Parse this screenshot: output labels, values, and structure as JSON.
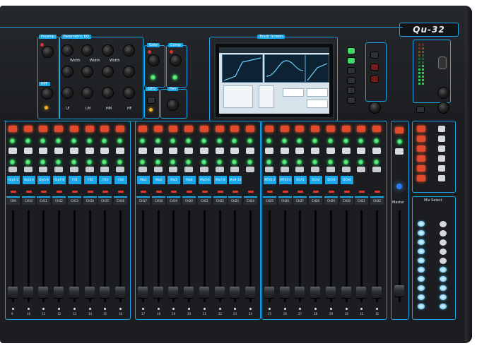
{
  "model": "Qu-32",
  "sections": {
    "preamp": "Preamp",
    "parametric_eq": "Parametric EQ",
    "hpf": "HPF",
    "gate": "Gate",
    "comp": "Comp",
    "geq": "GEQ",
    "pan": "Pan",
    "touch_screen": "Touch Screen",
    "mix_select": "Mix Select",
    "master": "Master"
  },
  "eq_labels": [
    "Width",
    "Width",
    "Width",
    "LF",
    "LM",
    "HM",
    "HF"
  ],
  "strip_labels_bank1": [
    "Grp1-2",
    "Grp3-4",
    "Grp5-6",
    "Grp7-8",
    "FX1",
    "FX2",
    "FX3",
    "FX4"
  ],
  "strip_labels_bank2": [
    "Mix1",
    "Mix2",
    "Mix3",
    "Mix4",
    "Mix5-6",
    "Mix7-8",
    "Mix9-10"
  ],
  "strip_labels_bank3": [
    "MTX1-2",
    "MTX3-4",
    "DCA1",
    "DCA2",
    "DCA3",
    "DCA4"
  ],
  "channel_names_bank1": [
    "CH9",
    "CH10",
    "CH11",
    "CH12",
    "CH13",
    "CH14",
    "CH15",
    "CH16"
  ],
  "channel_names_bank2": [
    "CH17",
    "CH18",
    "CH19",
    "CH20",
    "CH21",
    "CH22",
    "CH23",
    "CH24"
  ],
  "channel_names_bank3": [
    "CH25",
    "CH26",
    "CH27",
    "CH28",
    "CH29",
    "CH30",
    "CH31",
    "CH32"
  ],
  "fader_numbers_bank1": [
    "9",
    "10",
    "11",
    "12",
    "13",
    "14",
    "15",
    "16"
  ],
  "fader_numbers_bank2": [
    "17",
    "18",
    "19",
    "20",
    "21",
    "22",
    "23",
    "24"
  ],
  "fader_numbers_bank3": [
    "25",
    "26",
    "27",
    "28",
    "29",
    "30",
    "31",
    "32"
  ],
  "colors": {
    "accent": "#1aa7e8",
    "mute": "#e24a2e",
    "active_led": "#2aff6a",
    "desk": "#1b1d20"
  }
}
